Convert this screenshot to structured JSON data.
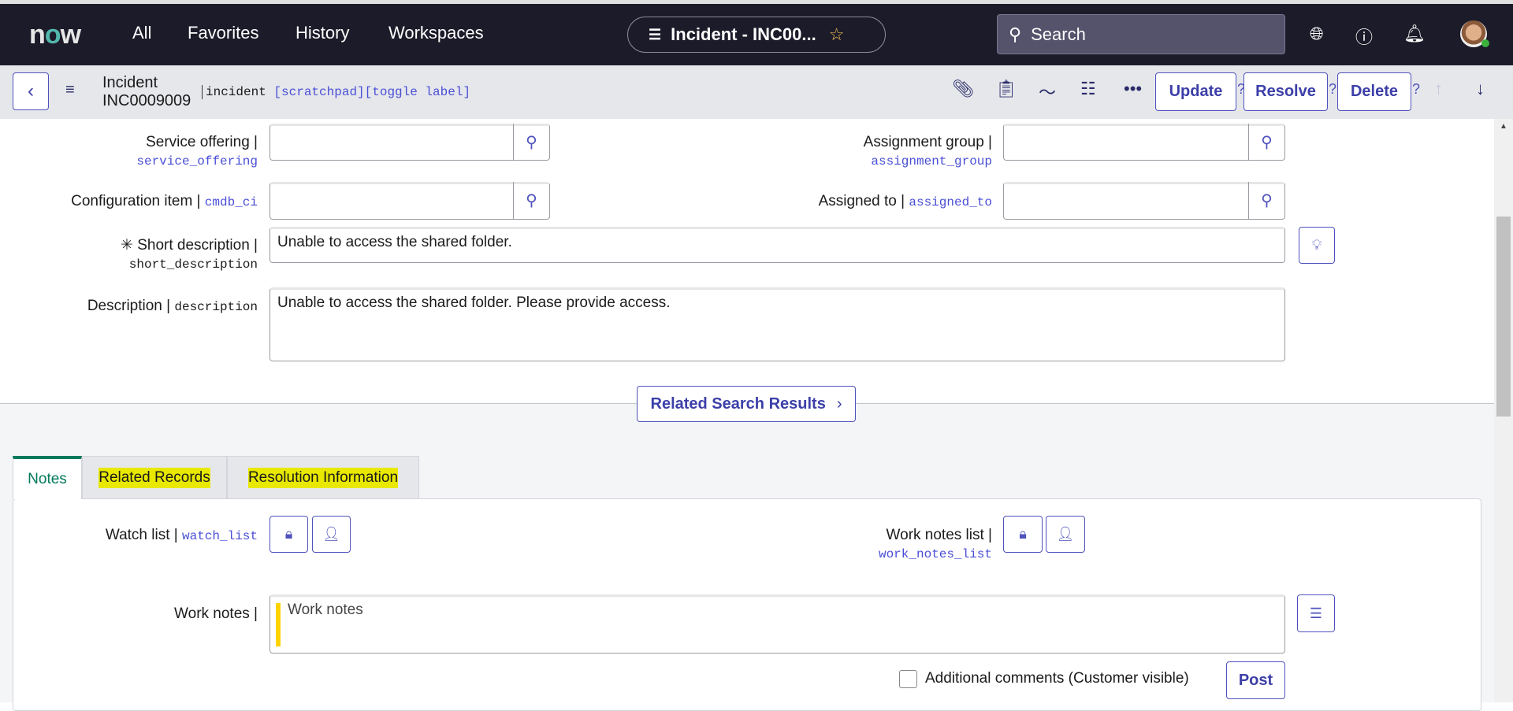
{
  "nav": {
    "logo": "now",
    "links": [
      "All",
      "Favorites",
      "History",
      "Workspaces"
    ],
    "pill_title": "Incident - INC00...",
    "search_placeholder": "Search"
  },
  "header": {
    "title": "Incident",
    "number": "INC0009009",
    "table": "incident",
    "scratchpad": "[scratchpad]",
    "toggle": "[toggle label]",
    "buttons": {
      "update": "Update",
      "resolve": "Resolve",
      "delete": "Delete"
    },
    "help": "?"
  },
  "form": {
    "service_offering": {
      "label": "Service offering |",
      "field": "service_offering",
      "value": ""
    },
    "configuration_item": {
      "label": "Configuration item |",
      "field": "cmdb_ci",
      "value": ""
    },
    "assignment_group": {
      "label": "Assignment group |",
      "field": "assignment_group",
      "value": ""
    },
    "assigned_to": {
      "label": "Assigned to |",
      "field": "assigned_to",
      "value": ""
    },
    "short_description": {
      "label": "Short description |",
      "field": "short_description",
      "value": "Unable to access the shared folder."
    },
    "description": {
      "label": "Description |",
      "field": "description",
      "value": "Unable to access the shared folder. Please provide access."
    }
  },
  "related_search": "Related Search Results",
  "tabs": [
    {
      "label": "Notes",
      "active": true
    },
    {
      "label": "Related Records",
      "highlighted": true
    },
    {
      "label": "Resolution Information",
      "highlighted": true
    }
  ],
  "notes": {
    "watch_list": {
      "label": "Watch list |",
      "field": "watch_list"
    },
    "work_notes_list": {
      "label": "Work notes list |",
      "field": "work_notes_list"
    },
    "work_notes": {
      "label": "Work notes |",
      "placeholder": "Work notes"
    },
    "additional_comments": {
      "label": "Additional comments (Customer visible)",
      "checked": false
    },
    "post": "Post"
  },
  "colors": {
    "nav_bg": "#1c1b29",
    "accent": "#4f52bd",
    "tab_active": "#00795c",
    "highlight": "#e8e800",
    "work_notes_bar": "#ffd200"
  }
}
